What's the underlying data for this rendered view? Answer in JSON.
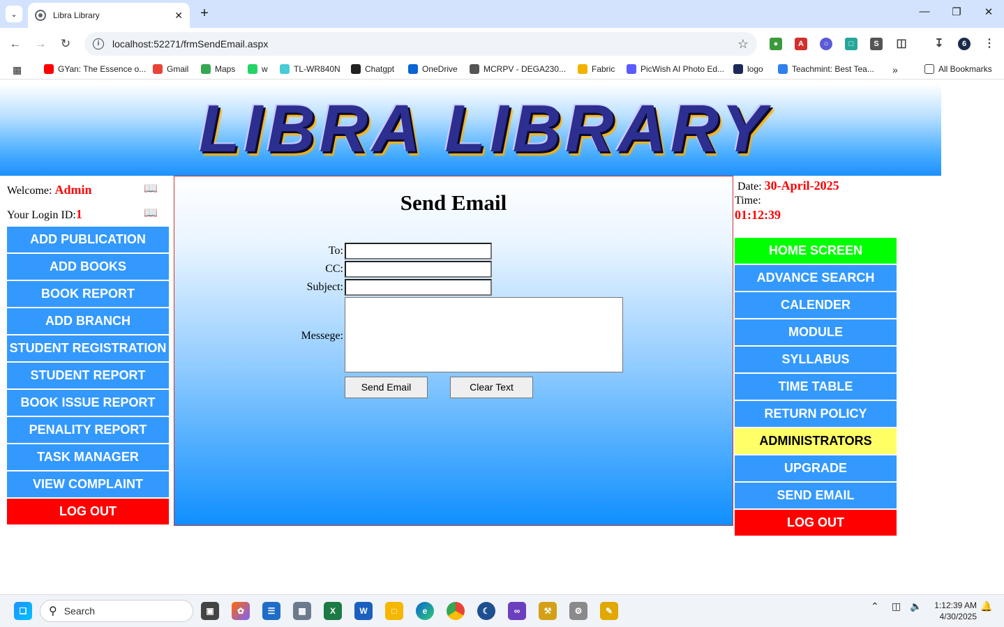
{
  "browser": {
    "tab_title": "Libra Library",
    "url": "localhost:52271/frmSendEmail.aspx",
    "bookmarks": [
      {
        "label": "GYan: The Essence o...",
        "color": "#ff0000"
      },
      {
        "label": "Gmail",
        "color": "#ea4335"
      },
      {
        "label": "Maps",
        "color": "#34a853"
      },
      {
        "label": "w",
        "color": "#25d366"
      },
      {
        "label": "TL-WR840N",
        "color": "#4acbd6"
      },
      {
        "label": "Chatgpt",
        "color": "#222222"
      },
      {
        "label": "OneDrive",
        "color": "#0a64d6"
      },
      {
        "label": "MCRPV - DEGA230...",
        "color": "#555555"
      },
      {
        "label": "Fabric",
        "color": "#f2b200"
      },
      {
        "label": "PicWish AI Photo Ed...",
        "color": "#5b5bff"
      },
      {
        "label": "logo",
        "color": "#1b2a5a"
      },
      {
        "label": "Teachmint: Best Tea...",
        "color": "#2f80ed"
      }
    ],
    "all_bookmarks": "All Bookmarks"
  },
  "banner": {
    "logo_text": "LIBRA LIBRARY"
  },
  "left": {
    "welcome_label": "Welcome: ",
    "welcome_value": "Admin",
    "login_label": "Your Login ID:",
    "login_value": "1",
    "menu": [
      {
        "label": "ADD PUBLICATION",
        "style": "blue"
      },
      {
        "label": "ADD BOOKS",
        "style": "blue"
      },
      {
        "label": "BOOK REPORT",
        "style": "blue"
      },
      {
        "label": "ADD BRANCH",
        "style": "blue"
      },
      {
        "label": "STUDENT REGISTRATION",
        "style": "blue"
      },
      {
        "label": "STUDENT REPORT",
        "style": "blue"
      },
      {
        "label": "BOOK ISSUE REPORT",
        "style": "blue"
      },
      {
        "label": "PENALITY REPORT",
        "style": "blue"
      },
      {
        "label": "TASK MANAGER",
        "style": "blue"
      },
      {
        "label": "VIEW COMPLAINT",
        "style": "blue"
      },
      {
        "label": "LOG OUT",
        "style": "red"
      }
    ]
  },
  "center": {
    "title": "Send Email",
    "to_label": "To:",
    "cc_label": "CC:",
    "subject_label": "Subject:",
    "message_label": "Messege:",
    "to_value": "",
    "cc_value": "",
    "subject_value": "",
    "message_value": "",
    "send_button": "Send Email",
    "clear_button": "Clear Text"
  },
  "right": {
    "date_label": "Date: ",
    "date_value": "30-April-2025",
    "time_label": "Time:",
    "time_value": "01:12:39",
    "menu": [
      {
        "label": "HOME SCREEN",
        "style": "green"
      },
      {
        "label": "ADVANCE SEARCH",
        "style": "blue"
      },
      {
        "label": "CALENDER",
        "style": "blue"
      },
      {
        "label": "MODULE",
        "style": "blue"
      },
      {
        "label": "SYLLABUS",
        "style": "blue"
      },
      {
        "label": "TIME TABLE",
        "style": "blue"
      },
      {
        "label": "RETURN POLICY",
        "style": "blue"
      },
      {
        "label": "ADMINISTRATORS",
        "style": "yellow"
      },
      {
        "label": "UPGRADE",
        "style": "blue"
      },
      {
        "label": "SEND EMAIL",
        "style": "blue"
      },
      {
        "label": "LOG OUT",
        "style": "red"
      }
    ]
  },
  "taskbar": {
    "search_placeholder": "Search",
    "time": "1:12:39 AM",
    "date": "4/30/2025"
  }
}
